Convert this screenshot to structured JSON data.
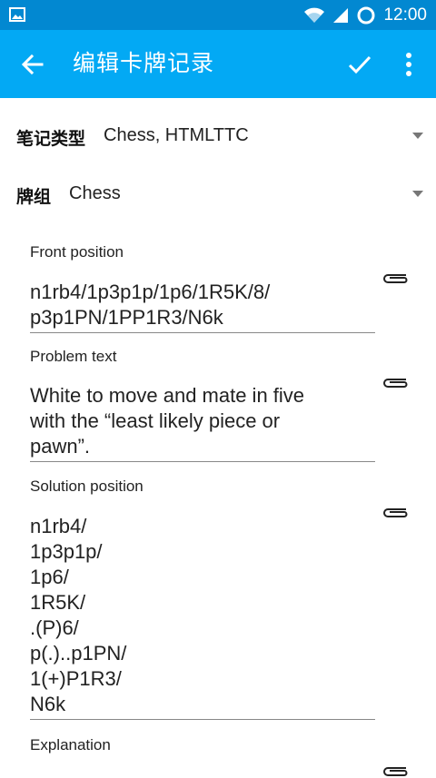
{
  "status_bar": {
    "time": "12:00"
  },
  "app_bar": {
    "title": "编辑卡牌记录"
  },
  "note_type": {
    "label": "笔记类型",
    "value": "Chess, HTMLTTC"
  },
  "deck": {
    "label": "牌组",
    "value": "Chess"
  },
  "fields": [
    {
      "label": "Front position",
      "value": "n1rb4/1p3p1p/1p6/1R5K/8/\np3p1PN/1PP1R3/N6k"
    },
    {
      "label": "Problem text",
      "value": "White to move and mate in five\nwith the “least likely piece or\npawn”."
    },
    {
      "label": "Solution position",
      "value": "n1rb4/\n1p3p1p/\n1p6/\n1R5K/\n.(P)6/\np(.)..p1PN/\n1(+)P1R3/\nN6k"
    },
    {
      "label": "Explanation",
      "value": ""
    }
  ]
}
